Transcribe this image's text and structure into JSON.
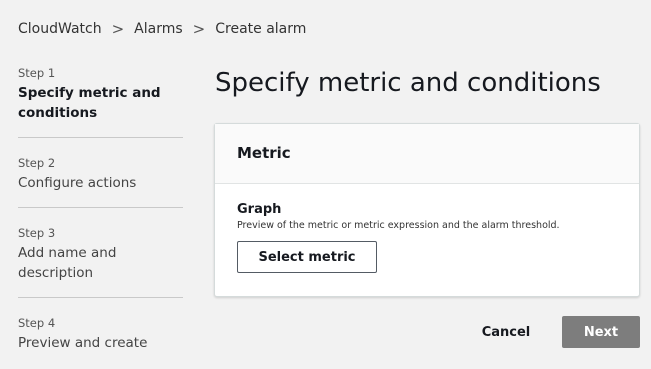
{
  "breadcrumb": {
    "items": [
      "CloudWatch",
      "Alarms",
      "Create alarm"
    ],
    "separator": ">"
  },
  "steps": [
    {
      "num": "Step 1",
      "title": "Specify metric and conditions",
      "active": true
    },
    {
      "num": "Step 2",
      "title": "Configure actions",
      "active": false
    },
    {
      "num": "Step 3",
      "title": "Add name and description",
      "active": false
    },
    {
      "num": "Step 4",
      "title": "Preview and create",
      "active": false
    }
  ],
  "main": {
    "title": "Specify metric and conditions",
    "panel": {
      "header": "Metric",
      "graph_title": "Graph",
      "graph_desc": "Preview of the metric or metric expression and the alarm threshold.",
      "select_button": "Select metric"
    }
  },
  "footer": {
    "cancel_label": "Cancel",
    "next_label": "Next"
  },
  "colors": {
    "next_button_bg": "#7d7d7d",
    "page_bg": "#f2f2f2"
  }
}
